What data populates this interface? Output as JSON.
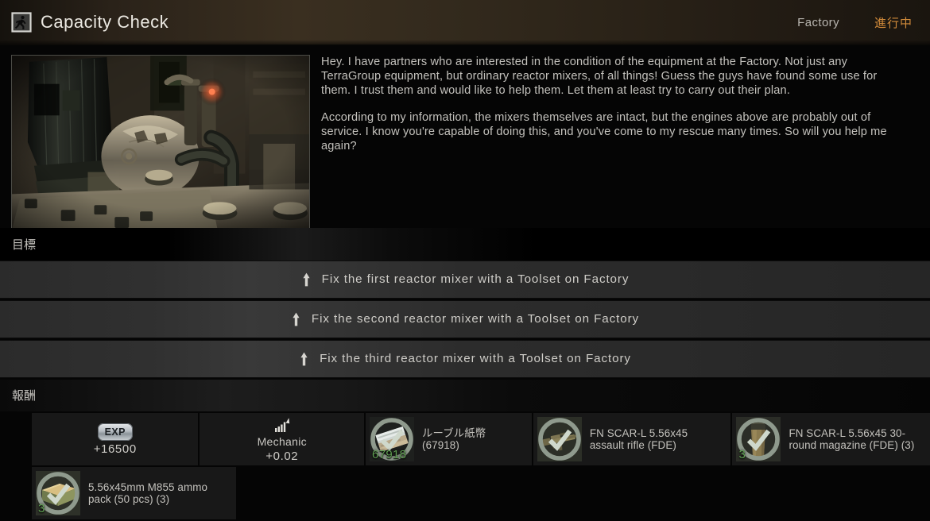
{
  "header": {
    "icon": "running-man-exit-icon",
    "title": "Capacity Check",
    "location": "Factory",
    "status": "進行中",
    "status_color": "#d08a3a"
  },
  "quest_image": {
    "alt": "reactor mixer machinery in factory basement"
  },
  "description": {
    "paragraph_1": "Hey. I have partners who are interested in the condition of the equipment at the Factory. Not just any TerraGroup equipment, but ordinary reactor mixers, of all things! Guess the guys have found some use for them. I trust them and would like to help them. Let them at least try to carry out their plan.",
    "paragraph_2": "According to my information, the mixers themselves are intact, but the engines above are probably out of service. I know you're capable of doing this, and you've come to my rescue many times. So will you help me again?"
  },
  "objectives": {
    "label": "目標",
    "items": [
      {
        "icon": "map-pin-icon",
        "text": "Fix the first reactor mixer with a Toolset on Factory"
      },
      {
        "icon": "map-pin-icon",
        "text": "Fix the second reactor mixer with a Toolset on Factory"
      },
      {
        "icon": "map-pin-icon",
        "text": "Fix the third reactor mixer with a Toolset on Factory"
      }
    ]
  },
  "rewards": {
    "label": "報酬",
    "exp": {
      "badge": "EXP",
      "value": "+16500"
    },
    "trader": {
      "icon": "rising-bar-chart-icon",
      "name": "Mechanic",
      "value": "+0.02"
    },
    "items": [
      {
        "icon": "rouble-banknotes-icon",
        "name": "ルーブル紙幣 (67918)",
        "count": "67918",
        "badge": "found-in-raid-icon"
      },
      {
        "icon": "assault-rifle-icon",
        "name": "FN SCAR-L 5.56x45 assault rifle (FDE)",
        "count": "",
        "badge": "found-in-raid-icon"
      },
      {
        "icon": "rifle-magazine-icon",
        "name": "FN SCAR-L 5.56x45 30-round magazine (FDE) (3)",
        "count": "3",
        "badge": "found-in-raid-icon"
      },
      {
        "icon": "ammo-pack-icon",
        "name": "5.56x45mm M855 ammo pack (50 pcs) (3)",
        "count": "3",
        "badge": "found-in-raid-icon"
      }
    ]
  }
}
